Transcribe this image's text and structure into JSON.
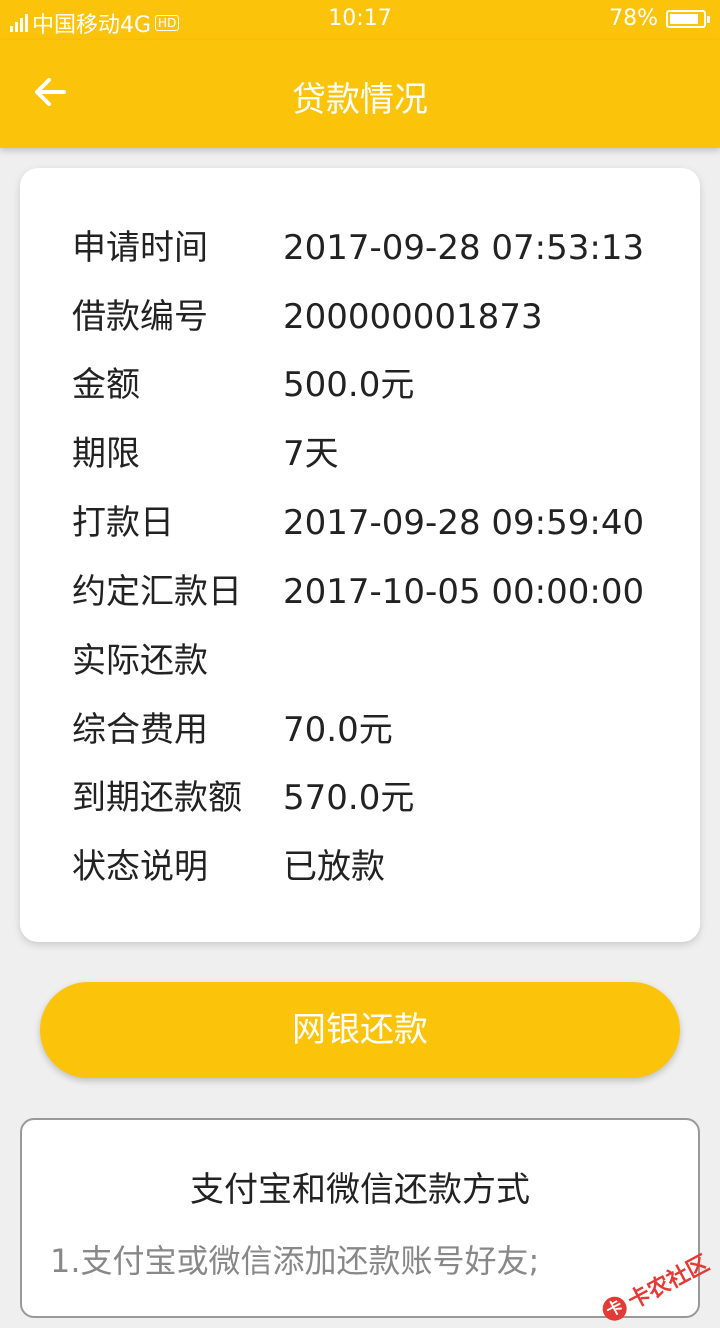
{
  "status_bar": {
    "carrier": "中国移动4G",
    "hd": "HD",
    "time": "10:17",
    "battery": "78%"
  },
  "header": {
    "title": "贷款情况",
    "back_icon": "arrow-left-icon"
  },
  "details": [
    {
      "label": "申请时间",
      "value": "2017-09-28 07:53:13"
    },
    {
      "label": "借款编号",
      "value": "200000001873"
    },
    {
      "label": "金额",
      "value": "500.0元"
    },
    {
      "label": "期限",
      "value": "7天"
    },
    {
      "label": "打款日",
      "value": "2017-09-28 09:59:40"
    },
    {
      "label": "约定汇款日",
      "value": "2017-10-05 00:00:00"
    },
    {
      "label": "实际还款",
      "value": ""
    },
    {
      "label": "综合费用",
      "value": "70.0元"
    },
    {
      "label": "到期还款额",
      "value": "570.0元"
    },
    {
      "label": "状态说明",
      "value": "已放款"
    }
  ],
  "repay_button": {
    "label": "网银还款"
  },
  "info_box": {
    "title": "支付宝和微信还款方式",
    "step1": "1.支付宝或微信添加还款账号好友;"
  },
  "watermark": {
    "text": "卡农社区",
    "logo": "卡"
  },
  "colors": {
    "primary": "#fcc30b",
    "background": "#efefef"
  }
}
